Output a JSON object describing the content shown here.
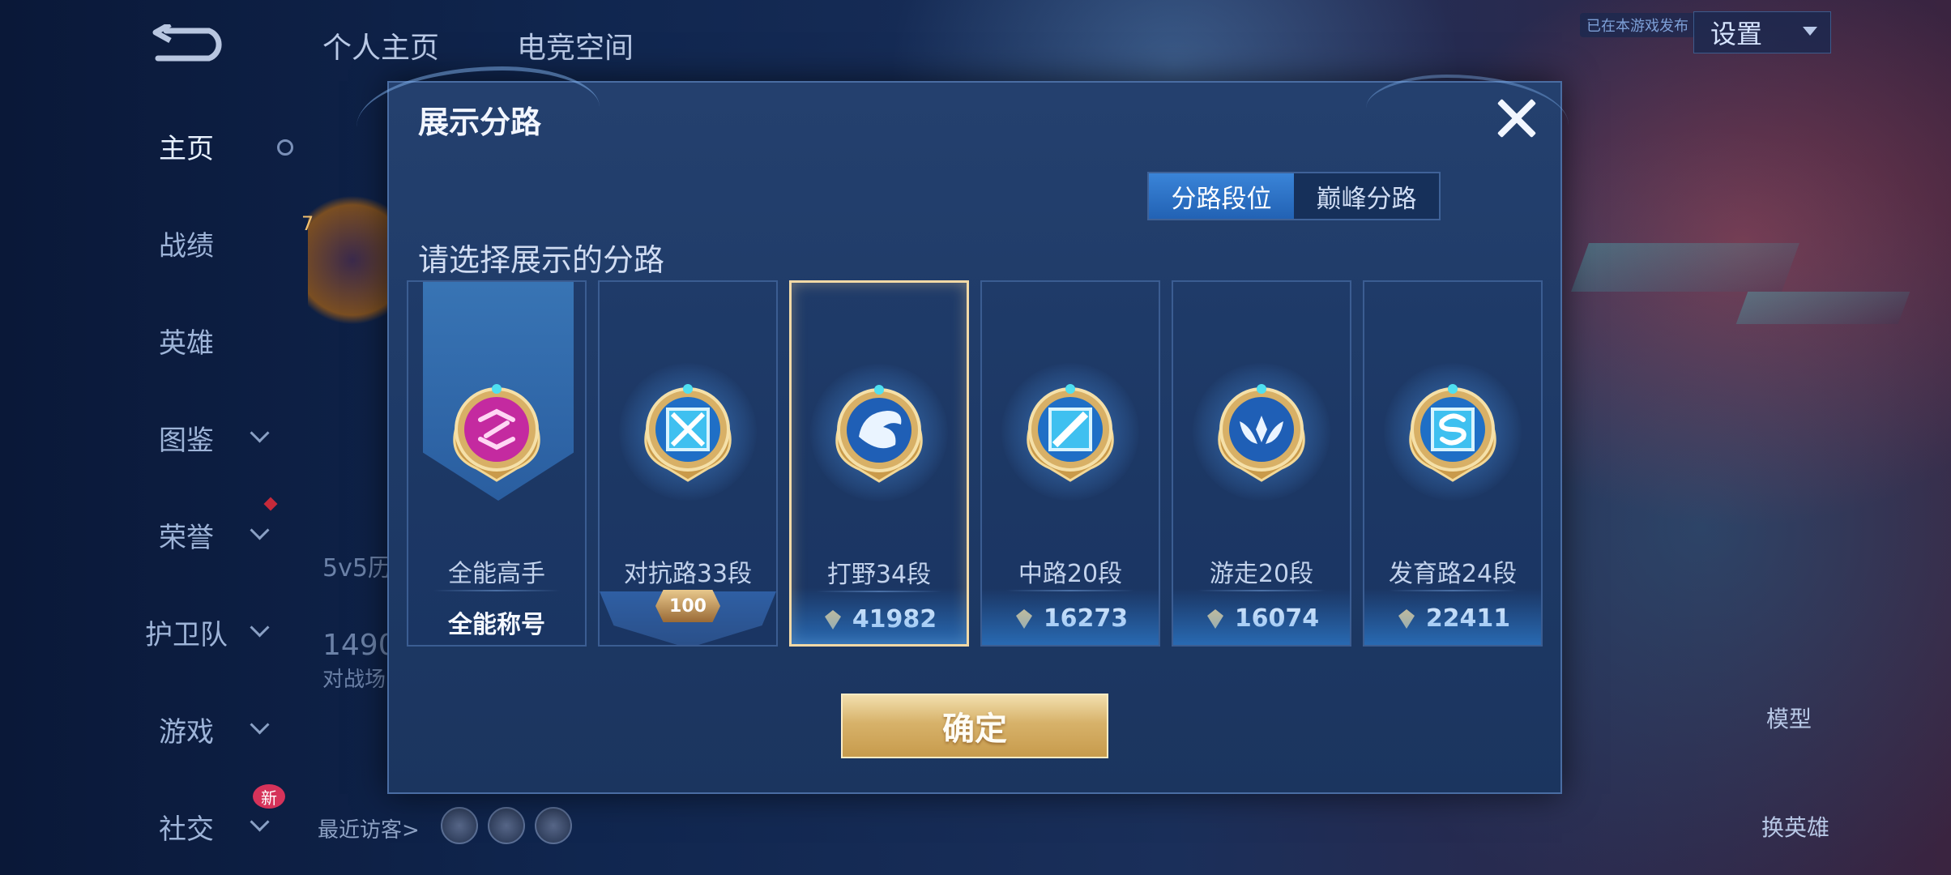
{
  "nav": {
    "items": [
      {
        "label": "主页",
        "active": true
      },
      {
        "label": "战绩"
      },
      {
        "label": "英雄"
      },
      {
        "label": "图鉴"
      },
      {
        "label": "荣誉"
      },
      {
        "label": "护卫队"
      },
      {
        "label": "游戏"
      },
      {
        "label": "社交"
      }
    ],
    "new_badge": "新"
  },
  "top_tabs": [
    "个人主页",
    "电竞空间"
  ],
  "settings_label": "设置",
  "status_badge": "已在本游戏发布",
  "background": {
    "history_text": "5v5历",
    "score_text": "1490",
    "score_sub": "对战场",
    "recent_visitors": "最近访客>",
    "model_label": "模型",
    "change_hero_label": "换英雄",
    "profile_level": "7"
  },
  "modal": {
    "title": "展示分路",
    "segments": [
      "分路段位",
      "巅峰分路"
    ],
    "active_segment": 0,
    "subtitle": "请选择展示的分路",
    "cards": [
      {
        "name": "全能高手",
        "value": "全能称号",
        "type": "allround",
        "selected": false
      },
      {
        "name": "对抗路33段",
        "value": "100",
        "type": "level",
        "selected": false
      },
      {
        "name": "打野34段",
        "value": "41982",
        "type": "score",
        "selected": true
      },
      {
        "name": "中路20段",
        "value": "16273",
        "type": "score",
        "selected": false
      },
      {
        "name": "游走20段",
        "value": "16074",
        "type": "score",
        "selected": false
      },
      {
        "name": "发育路24段",
        "value": "22411",
        "type": "score",
        "selected": false
      }
    ],
    "confirm_label": "确定"
  },
  "colors": {
    "accent": "#2f75cc",
    "gold": "#d7b26a",
    "allround": "#c42aa0"
  },
  "icons": [
    "back-icon",
    "close-icon",
    "settings-arrow-icon",
    "chevron-down-icon",
    "lane-gem-icon"
  ]
}
